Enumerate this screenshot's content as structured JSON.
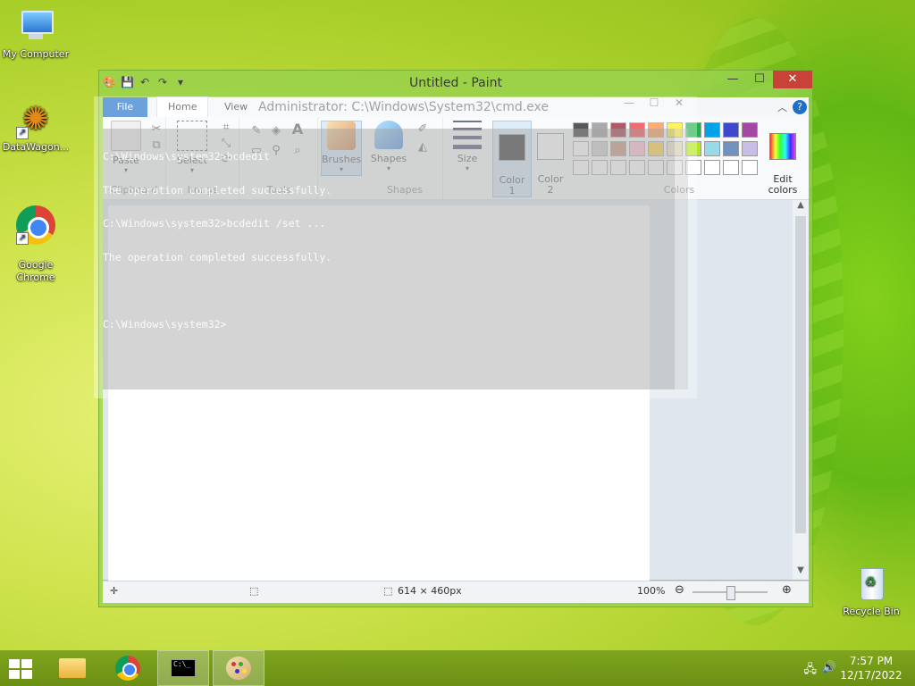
{
  "desktop": {
    "icons": [
      {
        "label": "My Computer"
      },
      {
        "label": "DataWagon..."
      },
      {
        "label": "Google\nChrome"
      },
      {
        "label": "Recycle Bin"
      }
    ]
  },
  "paint": {
    "title": "Untitled - Paint",
    "tabs": {
      "file": "File",
      "home": "Home",
      "view": "View"
    },
    "ribbon": {
      "clipboard": {
        "paste": "Paste",
        "group": "Clipboard"
      },
      "image": {
        "select": "Select",
        "group": "Image"
      },
      "tools": {
        "group": "Tools"
      },
      "brushes": "Brushes",
      "shapes": {
        "button": "Shapes",
        "group": "Shapes"
      },
      "size": "Size",
      "color1": "Color\n1",
      "color2": "Color\n2",
      "edit_colors": "Edit\ncolors",
      "colors_group": "Colors"
    },
    "palette": [
      "#000000",
      "#7f7f7f",
      "#880015",
      "#ed1c24",
      "#ff7f27",
      "#fff200",
      "#22b14c",
      "#00a2e8",
      "#3f48cc",
      "#a349a4",
      "#ffffff",
      "#c3c3c3",
      "#b97a57",
      "#ffaec9",
      "#ffc90e",
      "#efe4b0",
      "#b5e61d",
      "#99d9ea",
      "#7092be",
      "#c8bfe7",
      "#ffffff",
      "#ffffff",
      "#ffffff",
      "#ffffff",
      "#ffffff",
      "#ffffff",
      "#ffffff",
      "#ffffff",
      "#ffffff",
      "#ffffff"
    ],
    "status": {
      "dimensions": "614 × 460px",
      "zoom": "100%"
    }
  },
  "cmd": {
    "title": "Administrator: C:\\Windows\\System32\\cmd.exe",
    "lines": [
      "C:\\Windows\\system32>bcdedit",
      "The operation completed successfully.",
      "C:\\Windows\\system32>bcdedit /set ...",
      "The operation completed successfully.",
      "",
      "C:\\Windows\\system32>"
    ]
  },
  "taskbar": {
    "time": "7:57 PM",
    "date": "12/17/2022"
  }
}
